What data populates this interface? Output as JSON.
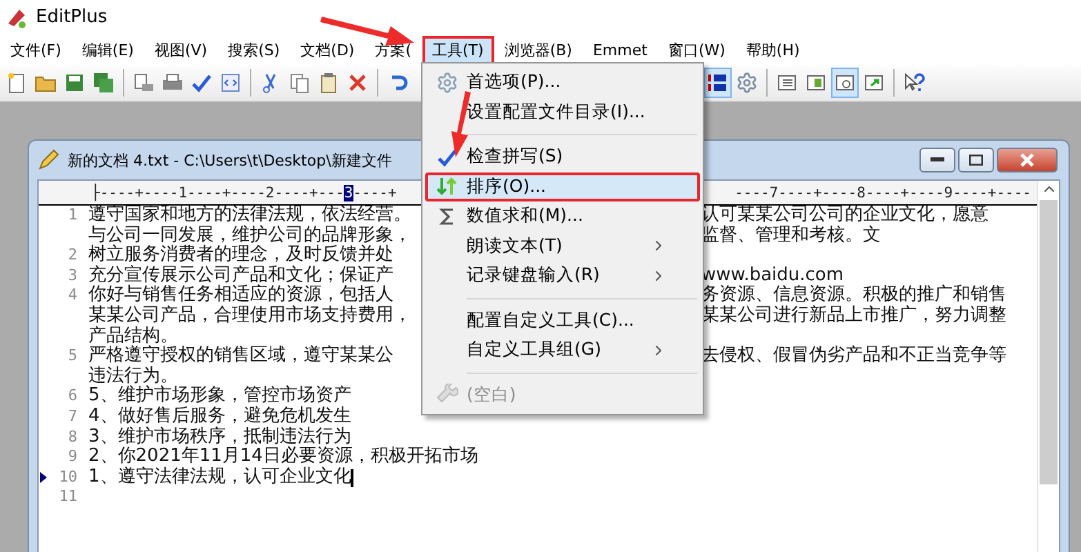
{
  "app": {
    "title": "EditPlus"
  },
  "menubar": [
    {
      "label": "文件(F)",
      "selected": false
    },
    {
      "label": "编辑(E)",
      "selected": false
    },
    {
      "label": "视图(V)",
      "selected": false
    },
    {
      "label": "搜索(S)",
      "selected": false
    },
    {
      "label": "文档(D)",
      "selected": false
    },
    {
      "label": "方案(",
      "selected": false
    },
    {
      "label": "工具(T)",
      "selected": true
    },
    {
      "label": "浏览器(B)",
      "selected": false
    },
    {
      "label": "Emmet",
      "selected": false
    },
    {
      "label": "窗口(W)",
      "selected": false
    },
    {
      "label": "帮助(H)",
      "selected": false
    }
  ],
  "toolbar": {
    "left": [
      {
        "pressed": false
      },
      {
        "pressed": false
      },
      {
        "pressed": false
      },
      {
        "pressed": false
      },
      {
        "pressed": false
      },
      {
        "pressed": false
      },
      {
        "pressed": false
      },
      {
        "pressed": false
      },
      {
        "pressed": false
      },
      {
        "pressed": false
      },
      {
        "pressed": false
      },
      {
        "pressed": false
      },
      {
        "pressed": false
      }
    ],
    "right": [
      {
        "pressed": true
      },
      {
        "pressed": false
      },
      {
        "pressed": false
      },
      {
        "pressed": false
      },
      {
        "pressed": true
      },
      {
        "pressed": false
      },
      {
        "pressed": false
      }
    ]
  },
  "document": {
    "title": "新的文档 4.txt - C:\\Users\\t\\Desktop\\新建文件",
    "ruler": {
      "left": "├----+----1----+----2----+---",
      "cursor": "3",
      "tail": "----+",
      "right": "----7----+----8----+----9----+----"
    },
    "lines": [
      {
        "number": "1",
        "current": false,
        "left": "遵守国家和地方的法律法规，依法经营。",
        "right": "认可某某公司公司的企业文化，愿意"
      },
      {
        "current": false,
        "left": "与公司一同发展，维护公司的品牌形象，",
        "right": "监督、管理和考核。文"
      },
      {
        "number": "2",
        "current": false,
        "left": "树立服务消费者的理念，及时反馈并处"
      },
      {
        "number": "3",
        "current": false,
        "left": "充分宣传展示公司产品和文化；保证产",
        "right": "www.baidu.com"
      },
      {
        "number": "4",
        "current": false,
        "left": "你好与销售任务相适应的资源，包括人",
        "right": "务资源、信息资源。积极的推广和销售"
      },
      {
        "current": false,
        "left": "某某公司产品，合理使用市场支持费用，",
        "right": "某某公司进行新品上市推广，努力调整"
      },
      {
        "current": false,
        "left": "产品结构。"
      },
      {
        "number": "5",
        "current": false,
        "left": "严格遵守授权的销售区域，遵守某某公",
        "right": "去侵权、假冒伪劣产品和不正当竞争等"
      },
      {
        "current": false,
        "left": "违法行为。"
      },
      {
        "number": "6",
        "current": false,
        "left": "5、维护市场形象，管控市场资产"
      },
      {
        "number": "7",
        "current": false,
        "left": "4、做好售后服务，避免危机发生"
      },
      {
        "number": "8",
        "current": false,
        "left": "3、维护市场秩序，抵制违法行为"
      },
      {
        "number": "9",
        "current": false,
        "left": "2、你2021年11月14日必要资源，积极开拓市场"
      },
      {
        "number": "10",
        "current": true,
        "left": "1、遵守法律法规，认可企业文化"
      },
      {
        "number": "11",
        "current": false
      }
    ]
  },
  "dropdown": [
    {
      "kind": "item",
      "label": "首选项(P)...",
      "selected": false,
      "disabled": false,
      "submenu": false
    },
    {
      "kind": "item",
      "label": "设置配置文件目录(I)...",
      "selected": false,
      "disabled": false,
      "submenu": false
    },
    {
      "kind": "separator"
    },
    {
      "kind": "item",
      "label": "检查拼写(S)",
      "selected": false,
      "disabled": false,
      "submenu": false
    },
    {
      "kind": "item",
      "label": "排序(O)...",
      "selected": true,
      "disabled": false,
      "submenu": false
    },
    {
      "kind": "item",
      "label": "数值求和(M)...",
      "selected": false,
      "disabled": false,
      "submenu": false
    },
    {
      "kind": "item",
      "label": "朗读文本(T)",
      "selected": false,
      "disabled": false,
      "submenu": true
    },
    {
      "kind": "item",
      "label": "记录键盘输入(R)",
      "selected": false,
      "disabled": false,
      "submenu": true
    },
    {
      "kind": "separator"
    },
    {
      "kind": "item",
      "label": "配置自定义工具(C)...",
      "selected": false,
      "disabled": false,
      "submenu": false
    },
    {
      "kind": "item",
      "label": "自定义工具组(G)",
      "selected": false,
      "disabled": false,
      "submenu": true
    },
    {
      "kind": "separator"
    },
    {
      "kind": "item",
      "label": "(空白)",
      "selected": false,
      "disabled": true,
      "submenu": false
    }
  ]
}
